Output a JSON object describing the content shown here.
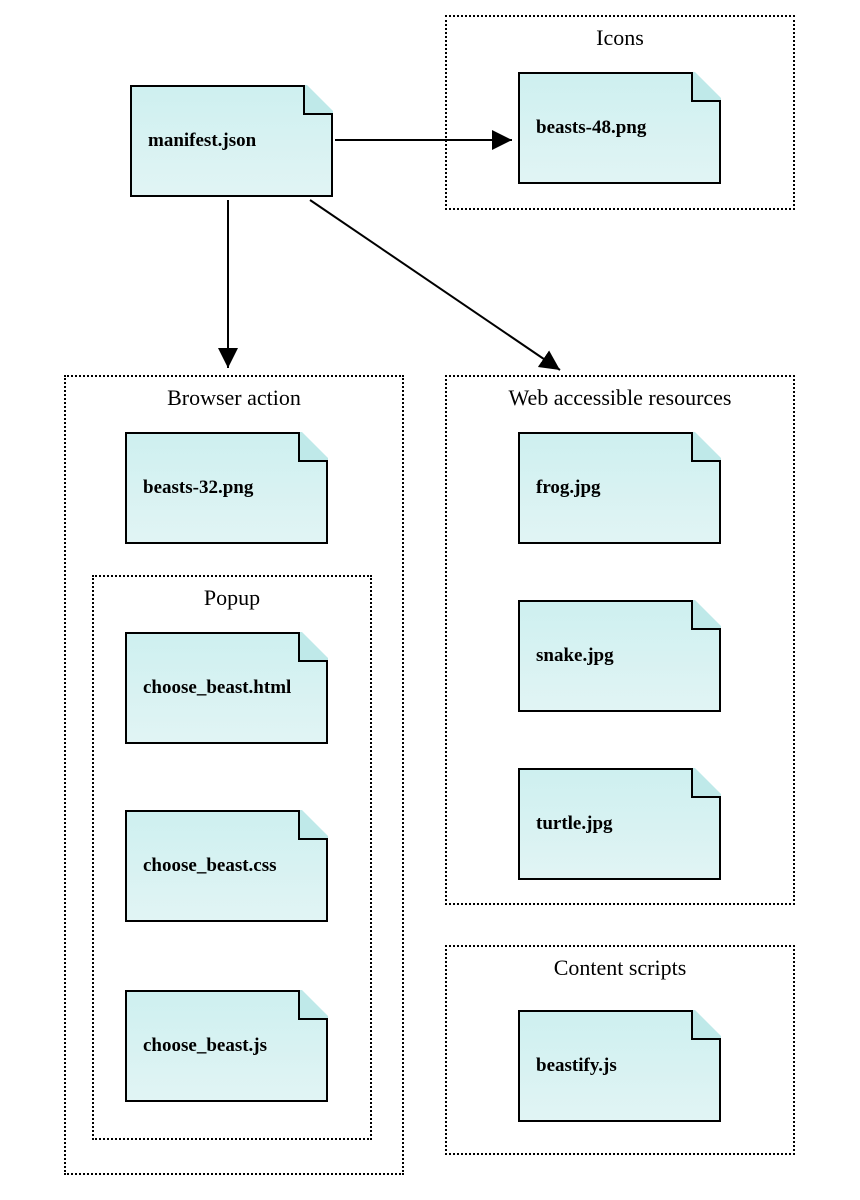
{
  "groups": {
    "icons": {
      "title": "Icons"
    },
    "browser_action": {
      "title": "Browser action"
    },
    "popup": {
      "title": "Popup"
    },
    "web_accessible": {
      "title": "Web accessible resources"
    },
    "content_scripts": {
      "title": "Content scripts"
    }
  },
  "files": {
    "manifest": "manifest.json",
    "beasts48": "beasts-48.png",
    "beasts32": "beasts-32.png",
    "choose_html": "choose_beast.html",
    "choose_css": "choose_beast.css",
    "choose_js": "choose_beast.js",
    "frog": "frog.jpg",
    "snake": "snake.jpg",
    "turtle": "turtle.jpg",
    "beastify": "beastify.js"
  }
}
